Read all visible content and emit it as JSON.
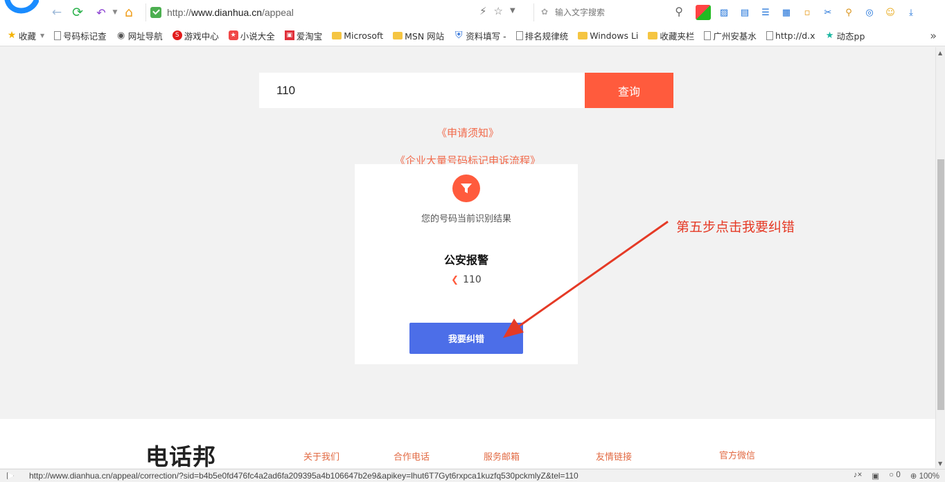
{
  "browser": {
    "url_prefix": "http://",
    "url_domain": "www.dianhua.cn",
    "url_path": "/appeal",
    "search_placeholder": "输入文字搜索"
  },
  "bookmarks": [
    {
      "label": "收藏",
      "icon": "star-icon"
    },
    {
      "label": "号码标记查",
      "icon": "page-icon"
    },
    {
      "label": "网址导航",
      "icon": "globe-icon"
    },
    {
      "label": "游戏中心",
      "icon": "game-icon"
    },
    {
      "label": "小说大全",
      "icon": "book-icon"
    },
    {
      "label": "爱淘宝",
      "icon": "taobao-icon"
    },
    {
      "label": "Microsoft",
      "icon": "folder-icon"
    },
    {
      "label": "MSN 网站",
      "icon": "folder-icon"
    },
    {
      "label": "资料填写 -",
      "icon": "shield-icon"
    },
    {
      "label": "排名规律统",
      "icon": "page-icon"
    },
    {
      "label": "Windows Li",
      "icon": "folder-icon"
    },
    {
      "label": "收藏夹栏",
      "icon": "folder-icon"
    },
    {
      "label": "广州安基水",
      "icon": "page-icon"
    },
    {
      "label": "http://d.x",
      "icon": "page-icon"
    },
    {
      "label": "动态pp",
      "icon": "star-icon"
    }
  ],
  "query": {
    "value": "110",
    "button_label": "查询"
  },
  "links": {
    "notice": "《申请须知》",
    "enterprise_flow": "《企业大量号码标记申诉流程》"
  },
  "result": {
    "caption": "您的号码当前识别结果",
    "name": "公安报警",
    "number": "110",
    "correct_button": "我要纠错"
  },
  "annotation": {
    "text": "第五步点击我要纠错",
    "color": "#e53a26"
  },
  "footer": {
    "logo": "电话邦",
    "links": [
      "关于我们",
      "合作电话",
      "服务邮箱",
      "友情链接",
      "官方微信"
    ]
  },
  "status": {
    "url": "http://www.dianhua.cn/appeal/correction/?sid=b4b5e0fd476fc4a2ad6fa209395a4b106647b2e9&apikey=lhut6T7Gyt6rxpca1kuzfq530pckmlyZ&tel=110",
    "counter": "0",
    "zoom": "100%"
  },
  "colors": {
    "accent_orange": "#ff5b3d",
    "button_blue": "#4c6ee8",
    "link_red": "#f26a4b"
  }
}
